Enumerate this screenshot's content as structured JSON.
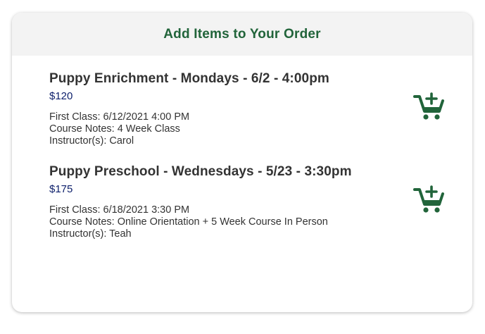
{
  "header": {
    "title": "Add Items to Your Order"
  },
  "items": [
    {
      "name": "Puppy Enrichment - Mondays - 6/2 - 4:00pm",
      "price": "$120",
      "first_class": "First Class: 6/12/2021 4:00 PM",
      "course_notes": "Course Notes: 4 Week Class",
      "instructors": "Instructor(s): Carol",
      "action_icon": "add-to-cart-icon"
    },
    {
      "name": "Puppy Preschool - Wednesdays - 5/23 - 3:30pm",
      "price": "$175",
      "first_class": "First Class: 6/18/2021 3:30 PM",
      "course_notes": "Course Notes: Online Orientation + 5 Week Course In Person",
      "instructors": "Instructor(s): Teah",
      "action_icon": "add-to-cart-icon"
    }
  ],
  "colors": {
    "accent": "#21643a",
    "price": "#0d1f6b",
    "text": "#333333",
    "header_bg": "#f3f3f3"
  }
}
